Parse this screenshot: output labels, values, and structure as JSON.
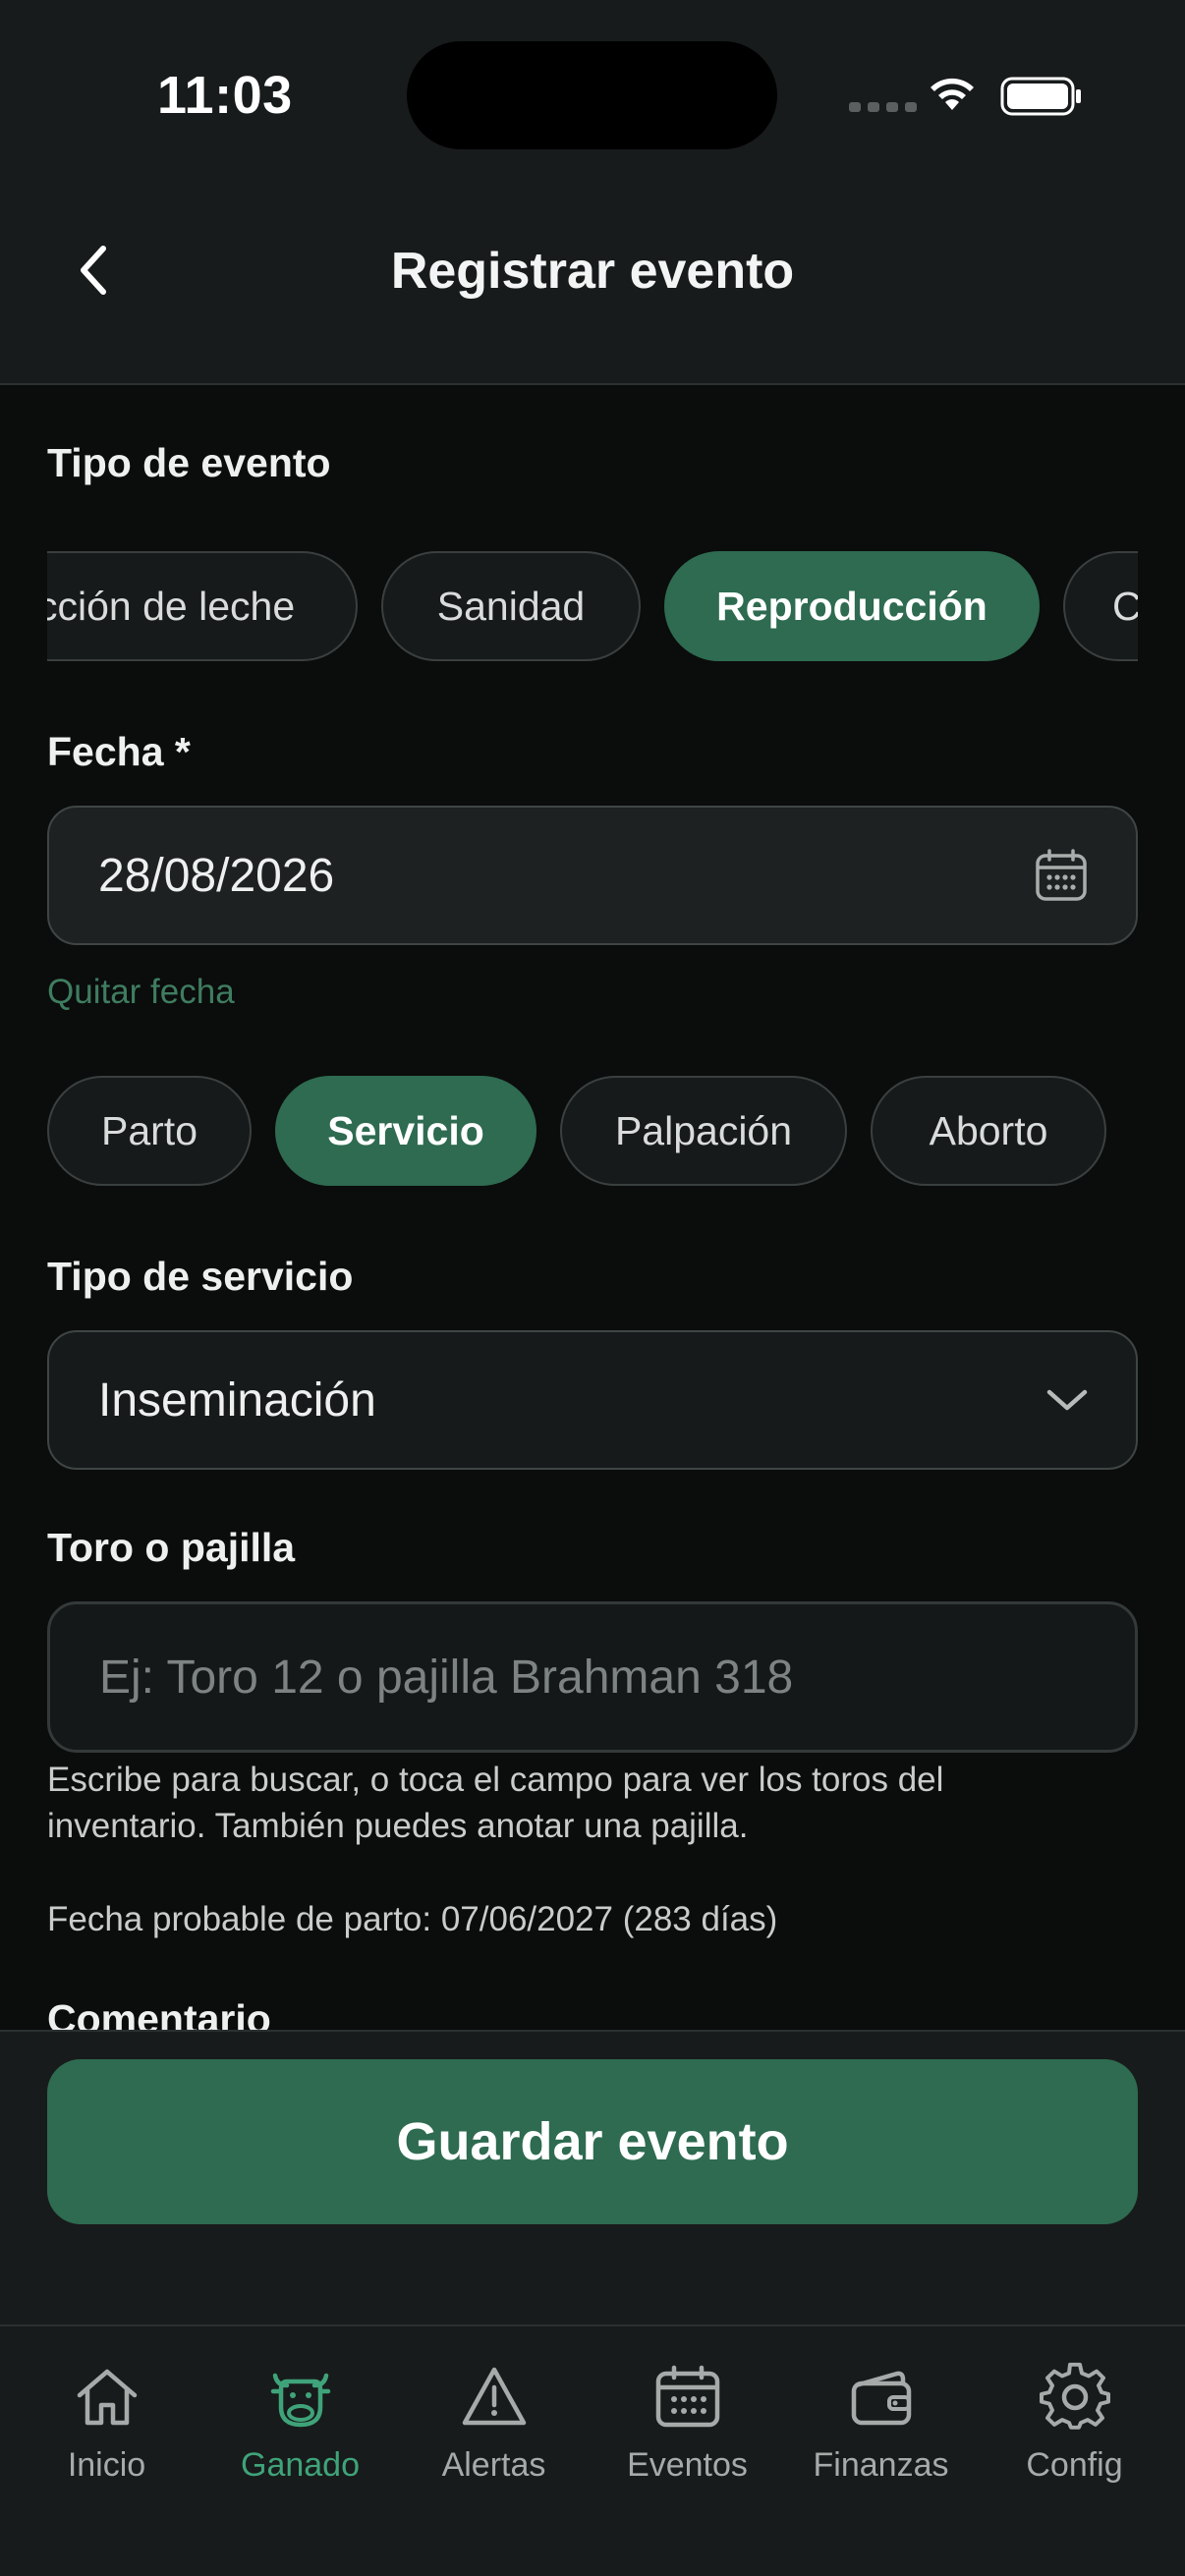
{
  "status_bar": {
    "time": "11:03"
  },
  "header": {
    "title": "Registrar evento"
  },
  "event_type": {
    "label": "Tipo de evento",
    "chips": [
      "cción de leche",
      "Sanidad",
      "Reproducción",
      "C"
    ],
    "selected": "Reproducción"
  },
  "date": {
    "label": "Fecha *",
    "value": "28/08/2026",
    "clear_link": "Quitar fecha"
  },
  "repro_types": {
    "chips": [
      "Parto",
      "Servicio",
      "Palpación",
      "Aborto"
    ],
    "selected": "Servicio"
  },
  "service_type": {
    "label": "Tipo de servicio",
    "value": "Inseminación"
  },
  "bull": {
    "label": "Toro o pajilla",
    "placeholder": "Ej: Toro 12 o pajilla Brahman 318",
    "help_line1": "Escribe para buscar, o toca el campo para ver los toros del",
    "help_line2": "inventario. También puedes anotar una pajilla.",
    "due_date": "Fecha probable de parto: 07/06/2027 (283 días)"
  },
  "comment": {
    "label": "Comentario"
  },
  "save_button": "Guardar evento",
  "tabbar": {
    "items": [
      {
        "label": "Inicio",
        "icon": "home-icon"
      },
      {
        "label": "Ganado",
        "icon": "cow-icon"
      },
      {
        "label": "Alertas",
        "icon": "warning-icon"
      },
      {
        "label": "Eventos",
        "icon": "calendar-icon"
      },
      {
        "label": "Finanzas",
        "icon": "wallet-icon"
      },
      {
        "label": "Config",
        "icon": "gear-icon"
      }
    ],
    "active": "Ganado"
  },
  "colors": {
    "accent": "#2e6b51",
    "accent_text": "#3fa37a",
    "background": "#0b0c0c",
    "surface": "#181b1b"
  }
}
